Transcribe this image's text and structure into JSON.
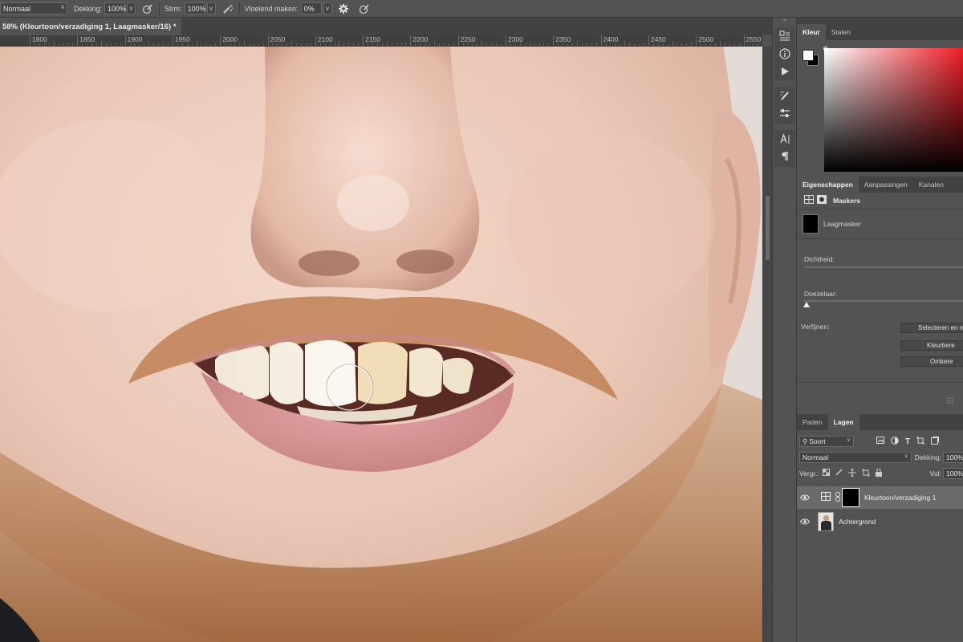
{
  "options_bar": {
    "mode": "Normaal",
    "opacity_label": "Dekking:",
    "opacity_value": "100%",
    "flow_label": "Strm:",
    "flow_value": "100%",
    "smoothing_label": "Vloeiend maken:",
    "smoothing_value": "0%"
  },
  "document_tab": {
    "title": "58% (Kleurtoon/verzadiging 1, Laagmasker/16) *"
  },
  "ruler": {
    "ticks": [
      "1800",
      "1850",
      "1900",
      "1950",
      "2000",
      "2050",
      "2100",
      "2150",
      "2200",
      "2250",
      "2300",
      "2350",
      "2400",
      "2450",
      "2500",
      "2550"
    ]
  },
  "color_panel": {
    "tabs": [
      "Kleur",
      "Stalen"
    ],
    "hue_color": "#ee1c24"
  },
  "properties_panel": {
    "tabs": [
      "Eigenschappen",
      "Aanpassingen",
      "Kanalen"
    ],
    "section_title": "Maskers",
    "mask_name": "Laagmasker",
    "density_label": "Dichtheid:",
    "feather_label": "Doezelaar:",
    "refine_label": "Verfijnen:",
    "buttons": [
      "Selecteren en m",
      "Kleurbere",
      "Omkere"
    ]
  },
  "layers_panel": {
    "tabs": [
      "Paden",
      "Lagen"
    ],
    "filter_label": "Soort",
    "blend_mode": "Normaal",
    "opacity_label": "Dekking:",
    "opacity_value": "100%",
    "lock_label": "Vergr.:",
    "fill_label": "Vul:",
    "fill_value": "100%",
    "layers": [
      {
        "name": "Kleurtoon/verzadiging 1",
        "selected": true
      },
      {
        "name": "Achtergrond",
        "selected": false
      }
    ]
  }
}
